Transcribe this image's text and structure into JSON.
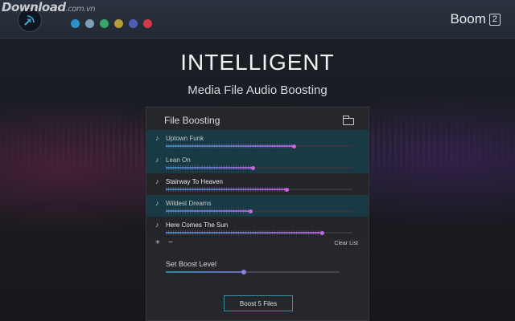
{
  "watermark": {
    "main": "Download",
    "sub": ".com.vn"
  },
  "header": {
    "brand": "Boom",
    "version": "2",
    "theme_colors": [
      "#2f8fc9",
      "#7fa0b3",
      "#3aa36a",
      "#b49c3a",
      "#4a5fb5",
      "#d2384a"
    ]
  },
  "hero": {
    "title": "INTELLIGENT",
    "subtitle": "Media File Audio Boosting"
  },
  "panel": {
    "title": "File Boosting",
    "files": [
      {
        "name": "Uptown Funk",
        "level": 0.68,
        "state": "highlighted"
      },
      {
        "name": "Lean On",
        "level": 0.46,
        "state": "highlighted"
      },
      {
        "name": "Stairway To Heaven",
        "level": 0.64,
        "state": "normal"
      },
      {
        "name": "Wildest Dreams",
        "level": 0.45,
        "state": "highlighted"
      },
      {
        "name": "Here Comes The Sun",
        "level": 0.83,
        "state": "normal"
      }
    ],
    "add_label": "+",
    "remove_label": "−",
    "clear_label": "Clear List",
    "boost_level_label": "Set Boost Level",
    "boost_level": 0.45,
    "boost_button": "Boost 5 Files"
  }
}
